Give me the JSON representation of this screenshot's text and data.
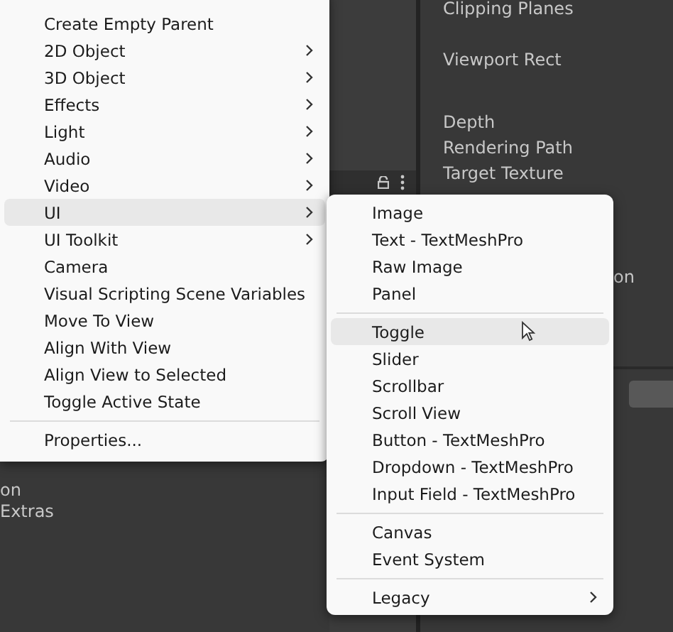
{
  "scene_panel": {
    "labels": [
      "on",
      "Extras"
    ]
  },
  "inspector": {
    "labels": [
      "Clipping Planes",
      "Viewport Rect",
      "Depth",
      "Rendering Path",
      "Target Texture",
      "on"
    ]
  },
  "context_menu": {
    "items": [
      {
        "kind": "item",
        "label": "Create Empty Parent",
        "submenu": false,
        "selected": false
      },
      {
        "kind": "item",
        "label": "2D Object",
        "submenu": true,
        "selected": false
      },
      {
        "kind": "item",
        "label": "3D Object",
        "submenu": true,
        "selected": false
      },
      {
        "kind": "item",
        "label": "Effects",
        "submenu": true,
        "selected": false
      },
      {
        "kind": "item",
        "label": "Light",
        "submenu": true,
        "selected": false
      },
      {
        "kind": "item",
        "label": "Audio",
        "submenu": true,
        "selected": false
      },
      {
        "kind": "item",
        "label": "Video",
        "submenu": true,
        "selected": false
      },
      {
        "kind": "item",
        "label": "UI",
        "submenu": true,
        "selected": true
      },
      {
        "kind": "item",
        "label": "UI Toolkit",
        "submenu": true,
        "selected": false
      },
      {
        "kind": "item",
        "label": "Camera",
        "submenu": false,
        "selected": false
      },
      {
        "kind": "item",
        "label": "Visual Scripting Scene Variables",
        "submenu": false,
        "selected": false
      },
      {
        "kind": "item",
        "label": "Move To View",
        "submenu": false,
        "selected": false
      },
      {
        "kind": "item",
        "label": "Align With View",
        "submenu": false,
        "selected": false
      },
      {
        "kind": "item",
        "label": "Align View to Selected",
        "submenu": false,
        "selected": false
      },
      {
        "kind": "item",
        "label": "Toggle Active State",
        "submenu": false,
        "selected": false
      },
      {
        "kind": "separator"
      },
      {
        "kind": "item",
        "label": "Properties...",
        "submenu": false,
        "selected": false
      }
    ]
  },
  "submenu": {
    "items": [
      {
        "kind": "item",
        "label": "Image",
        "submenu": false,
        "selected": false
      },
      {
        "kind": "item",
        "label": "Text - TextMeshPro",
        "submenu": false,
        "selected": false
      },
      {
        "kind": "item",
        "label": "Raw Image",
        "submenu": false,
        "selected": false
      },
      {
        "kind": "item",
        "label": "Panel",
        "submenu": false,
        "selected": false
      },
      {
        "kind": "separator"
      },
      {
        "kind": "item",
        "label": "Toggle",
        "submenu": false,
        "selected": true
      },
      {
        "kind": "item",
        "label": "Slider",
        "submenu": false,
        "selected": false
      },
      {
        "kind": "item",
        "label": "Scrollbar",
        "submenu": false,
        "selected": false
      },
      {
        "kind": "item",
        "label": "Scroll View",
        "submenu": false,
        "selected": false
      },
      {
        "kind": "item",
        "label": "Button - TextMeshPro",
        "submenu": false,
        "selected": false
      },
      {
        "kind": "item",
        "label": "Dropdown - TextMeshPro",
        "submenu": false,
        "selected": false
      },
      {
        "kind": "item",
        "label": "Input Field - TextMeshPro",
        "submenu": false,
        "selected": false
      },
      {
        "kind": "separator"
      },
      {
        "kind": "item",
        "label": "Canvas",
        "submenu": false,
        "selected": false
      },
      {
        "kind": "item",
        "label": "Event System",
        "submenu": false,
        "selected": false
      },
      {
        "kind": "separator"
      },
      {
        "kind": "item",
        "label": "Legacy",
        "submenu": true,
        "selected": false
      }
    ]
  }
}
